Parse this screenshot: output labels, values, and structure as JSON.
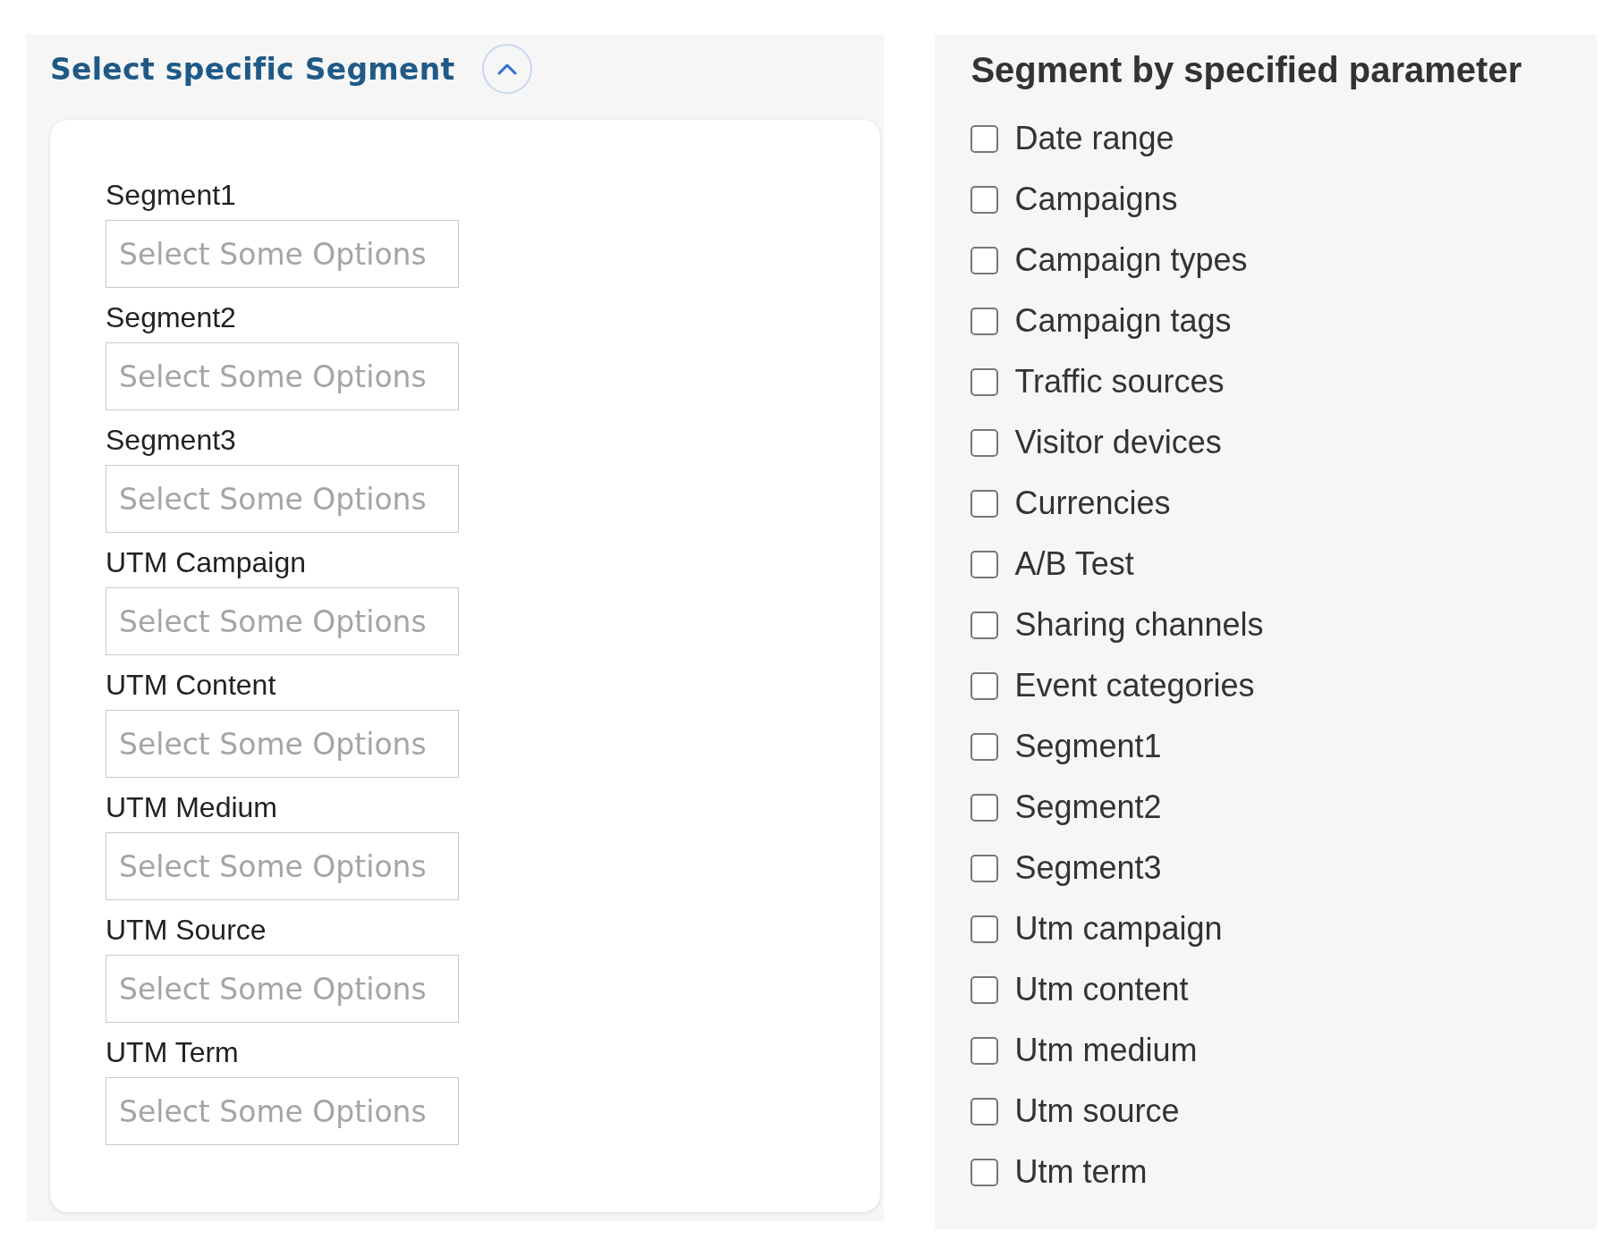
{
  "segment_panel": {
    "title": "Select specific Segment",
    "expanded": true,
    "fields": [
      {
        "label": "Segment1",
        "placeholder": "Select Some Options"
      },
      {
        "label": "Segment2",
        "placeholder": "Select Some Options"
      },
      {
        "label": "Segment3",
        "placeholder": "Select Some Options"
      },
      {
        "label": "UTM Campaign",
        "placeholder": "Select Some Options"
      },
      {
        "label": "UTM Content",
        "placeholder": "Select Some Options"
      },
      {
        "label": "UTM Medium",
        "placeholder": "Select Some Options"
      },
      {
        "label": "UTM Source",
        "placeholder": "Select Some Options"
      },
      {
        "label": "UTM Term",
        "placeholder": "Select Some Options"
      }
    ]
  },
  "parameter_panel": {
    "title": "Segment by specified parameter",
    "options": [
      {
        "label": "Date range",
        "checked": false
      },
      {
        "label": "Campaigns",
        "checked": false
      },
      {
        "label": "Campaign types",
        "checked": false
      },
      {
        "label": "Campaign tags",
        "checked": false
      },
      {
        "label": "Traffic sources",
        "checked": false
      },
      {
        "label": "Visitor devices",
        "checked": false
      },
      {
        "label": "Currencies",
        "checked": false
      },
      {
        "label": "A/B Test",
        "checked": false
      },
      {
        "label": "Sharing channels",
        "checked": false
      },
      {
        "label": "Event categories",
        "checked": false
      },
      {
        "label": "Segment1",
        "checked": false
      },
      {
        "label": "Segment2",
        "checked": false
      },
      {
        "label": "Segment3",
        "checked": false
      },
      {
        "label": "Utm campaign",
        "checked": false
      },
      {
        "label": "Utm content",
        "checked": false
      },
      {
        "label": "Utm medium",
        "checked": false
      },
      {
        "label": "Utm source",
        "checked": false
      },
      {
        "label": "Utm term",
        "checked": false
      }
    ]
  }
}
